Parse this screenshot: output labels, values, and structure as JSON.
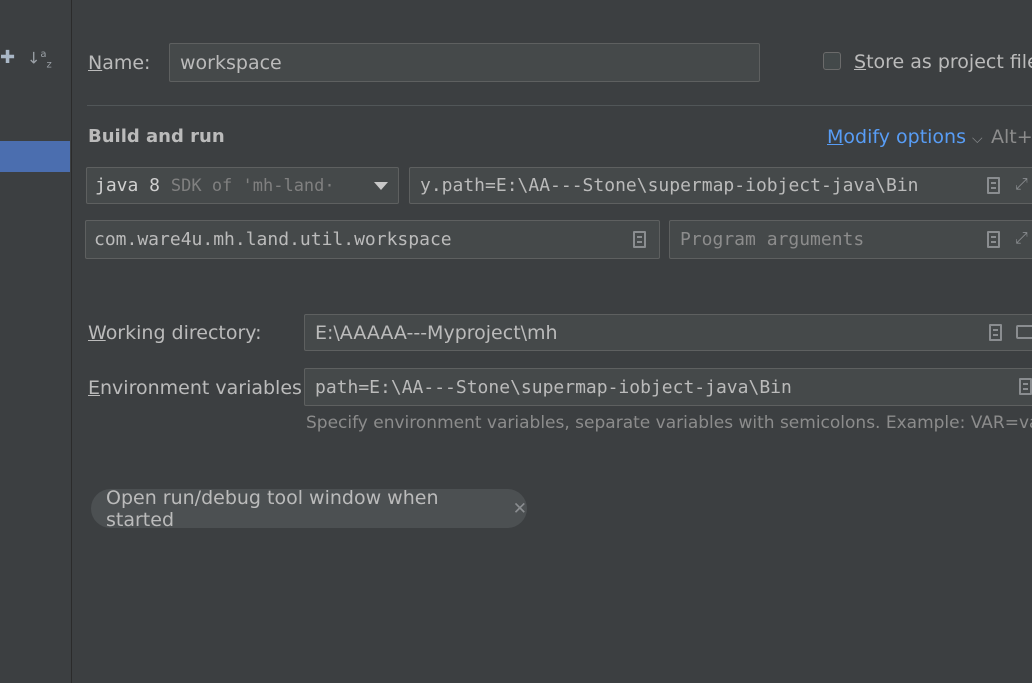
{
  "name": {
    "label": "Name:",
    "label_mnemonic": "N",
    "label_rest": "ame:",
    "value": "workspace"
  },
  "store_project": {
    "label_mnemonic": "S",
    "label_rest": "tore as project file",
    "checked": false
  },
  "build_run": {
    "heading": "Build and run",
    "modify_options_mnemonic": "M",
    "modify_options_rest": "odify options",
    "shortcut": "Alt+M",
    "sdk_bold": "java 8",
    "sdk_suffix": "SDK of 'mh-land·",
    "vm_options": "y.path=E:\\AA---Stone\\supermap-iobject-java\\Bin",
    "main_class": "com.ware4u.mh.land.util.workspace",
    "program_args_placeholder": "Program arguments"
  },
  "working_dir": {
    "label_mnemonic": "W",
    "label_rest": "orking directory:",
    "value": "E:\\AAAAA---Myproject\\mh"
  },
  "env_vars": {
    "label_mnemonic": "E",
    "label_rest": "nvironment variables:",
    "value": "path=E:\\AA---Stone\\supermap-iobject-java\\Bin",
    "hint": "Specify environment variables, separate variables with semicolons. Example: VAR=value"
  },
  "chip": {
    "label": "Open run/debug tool window when started"
  },
  "toolbar": {
    "add_icon": "+",
    "sort_icon": "↓a z"
  },
  "colors": {
    "background": "#3c3f41",
    "field": "#45494a",
    "selection": "#4b6eaf",
    "link": "#589df6"
  }
}
